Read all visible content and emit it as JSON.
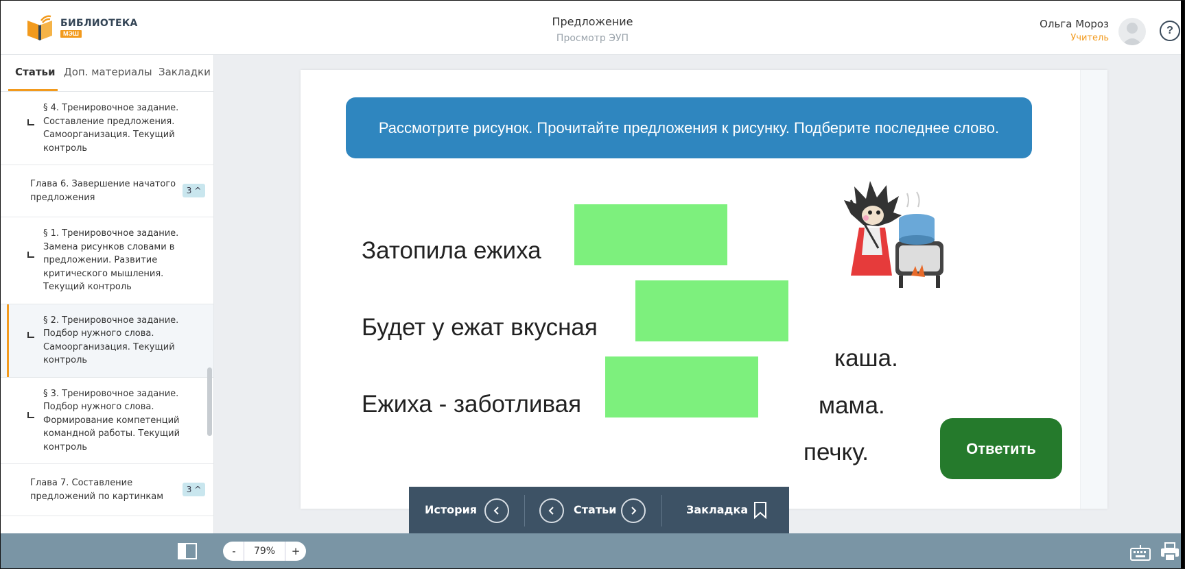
{
  "header": {
    "logo_text": "БИБЛИОТЕКА",
    "logo_sub": "МЭШ",
    "title": "Предложение",
    "subtitle": "Просмотр ЭУП",
    "user_name": "Ольга Мороз",
    "user_role": "Учитель",
    "help_label": "?"
  },
  "sidebar": {
    "tabs": [
      "Статьи",
      "Доп. материалы",
      "Закладки"
    ],
    "items": [
      {
        "type": "sub",
        "text": "§ 4. Тренировочное задание. Составление предложения. Самоорганизация. Текущий контроль"
      },
      {
        "type": "chapter",
        "text": "Глава 6. Завершение начатого предложения",
        "badge": "3"
      },
      {
        "type": "sub",
        "text": "§ 1. Тренировочное задание. Замена рисунков словами в предложении. Развитие критического мышления. Текущий контроль"
      },
      {
        "type": "sub",
        "text": "§ 2. Тренировочное задание. Подбор нужного слова. Самоорганизация. Текущий контроль",
        "active": true
      },
      {
        "type": "sub",
        "text": "§ 3. Тренировочное задание. Подбор нужного слова. Формирование компетенций командной работы. Текущий контроль"
      },
      {
        "type": "chapter",
        "text": "Глава 7. Составление предложений по картинкам",
        "badge": "3"
      }
    ]
  },
  "task": {
    "instruction": "Рассмотрите рисунок. Прочитайте предложения к рисунку. Подберите последнее слово.",
    "sentences": [
      "Затопила ежиха",
      "Будет у ежат вкусная",
      "Ежиха - заботливая"
    ],
    "words": [
      "каша.",
      "мама.",
      "печку."
    ],
    "answer_label": "Ответить"
  },
  "navbar": {
    "history_label": "История",
    "articles_label": "Статьи",
    "bookmark_label": "Закладка"
  },
  "bottombar": {
    "zoom_minus": "-",
    "zoom_value": "79%",
    "zoom_plus": "+"
  },
  "colors": {
    "accent": "#f29a1d",
    "instruction_bg": "#2f86bf",
    "drop_zone": "#7df07d",
    "answer_button": "#257a2c",
    "navbar_bg": "#3d5265",
    "bottombar_bg": "#7a95a5"
  },
  "icons": [
    "book-logo-icon",
    "help-icon",
    "avatar-icon",
    "chevron-left-icon",
    "chevron-right-icon",
    "bookmark-icon",
    "layout-toggle-icon",
    "keyboard-icon",
    "print-icon",
    "hedgehog-illustration"
  ]
}
